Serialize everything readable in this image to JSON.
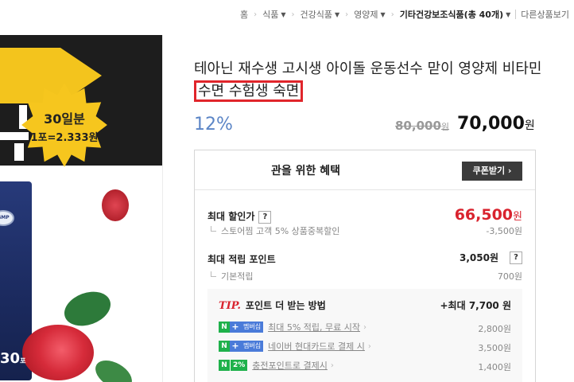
{
  "breadcrumb": {
    "items": [
      {
        "label": "홈",
        "dropdown": false
      },
      {
        "label": "식품",
        "dropdown": true
      },
      {
        "label": "건강식품",
        "dropdown": true
      },
      {
        "label": "영양제",
        "dropdown": true
      },
      {
        "label": "기타건강보조식품(총 40개)",
        "dropdown": true
      },
      {
        "label": "다른상품보기",
        "dropdown": false
      }
    ]
  },
  "product_image": {
    "badge_line1": "30일분",
    "badge_line2": "1포=2.333원",
    "gmp": "GMP",
    "dose": "30",
    "dose_unit": "포"
  },
  "product": {
    "title_prefix": "테아닌 재수생 고시생 아이돌 운동선수 맏이 영양제 비타민 ",
    "title_highlight": "수면 수험생 숙면",
    "discount_rate": "12%",
    "original_price": "80,000",
    "original_price_unit": "원",
    "price": "70,000",
    "price_unit": "원"
  },
  "benefits": {
    "title": "관을 위한 혜택",
    "coupon_button": "쿠폰받기 ›",
    "max_discount": {
      "label": "최대 할인가",
      "help": "?",
      "value": "66,500",
      "unit": "원",
      "sub_label": "스토어찜 고객 5% 상품중복할인",
      "sub_value": "-3,500원"
    },
    "max_points": {
      "label": "최대 적립 포인트",
      "value": "3,050원",
      "help": "?",
      "sub_label": "기본적립",
      "sub_value": "700원"
    },
    "tip": {
      "tag": "TIP.",
      "title": "포인트 더 받는 방법",
      "max": "+최대 7,700 원",
      "rows": [
        {
          "badge_n": "N",
          "badge_plus": "+",
          "badge_text": "멤버십",
          "text": "최대 5% 적립, 무료 시작",
          "value": "2,800원"
        },
        {
          "badge_n": "N",
          "badge_plus": "+",
          "badge_text": "멤버십",
          "text": "네이버 현대카드로 결제 시",
          "value": "3,500원"
        },
        {
          "badge_n": "N",
          "badge_pct": "2%",
          "text": "충전포인트로 결제시",
          "value": "1,400원"
        }
      ]
    }
  }
}
